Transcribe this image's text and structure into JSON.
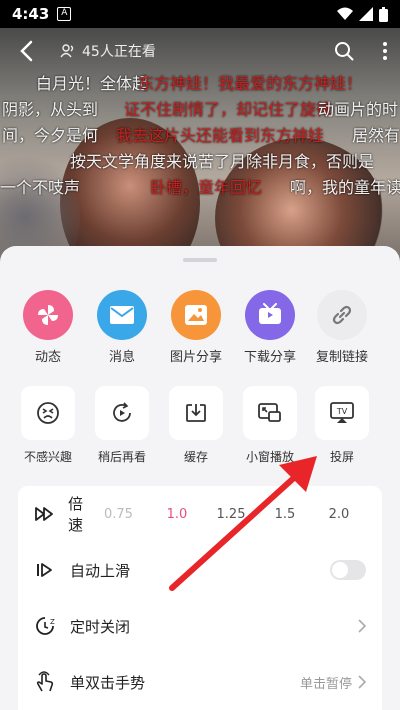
{
  "status_bar": {
    "time": "4:43",
    "notification": "A"
  },
  "top_bar": {
    "viewers": "45人正在看"
  },
  "danmaku": [
    {
      "text": "白月光！全体起",
      "color": "white"
    },
    {
      "text": "东方神娃！我最爱的东方神娃！",
      "color": "red"
    },
    {
      "text": "阴影，从头到",
      "color": "white"
    },
    {
      "text": "证不住剧情了，却记住了旋律",
      "color": "red"
    },
    {
      "text": "动画片的时",
      "color": "white"
    },
    {
      "text": "间，今夕是何",
      "color": "white"
    },
    {
      "text": "我去这片头还能看到东方神娃",
      "color": "red"
    },
    {
      "text": "居然有",
      "color": "white"
    },
    {
      "text": "按天文学角度来说苦了月除非月食，否则是",
      "color": "white"
    },
    {
      "text": "一个不吱声",
      "color": "white"
    },
    {
      "text": "卧槽，童年回忆",
      "color": "red"
    },
    {
      "text": "啊，我的童年读",
      "color": "white"
    }
  ],
  "share": [
    {
      "label": "动态",
      "icon": "pinwheel-icon",
      "color": "#f0648e"
    },
    {
      "label": "消息",
      "icon": "envelope-icon",
      "color": "#3aa7e8"
    },
    {
      "label": "图片分享",
      "icon": "image-icon",
      "color": "#f7953a"
    },
    {
      "label": "下载分享",
      "icon": "tv-download-icon",
      "color": "#8468e8"
    },
    {
      "label": "复制链接",
      "icon": "link-icon",
      "color": "#ececef"
    }
  ],
  "actions": [
    {
      "label": "不感兴趣",
      "icon": "dislike-face-icon"
    },
    {
      "label": "稍后再看",
      "icon": "watch-later-icon"
    },
    {
      "label": "缓存",
      "icon": "cache-icon"
    },
    {
      "label": "小窗播放",
      "icon": "mini-window-icon"
    },
    {
      "label": "投屏",
      "icon": "cast-tv-icon"
    }
  ],
  "settings": {
    "speed": {
      "label": "倍速",
      "options": [
        "0.75",
        "1.0",
        "1.25",
        "1.5",
        "2.0"
      ],
      "selected": "1.0"
    },
    "autoplay": {
      "label": "自动上滑",
      "enabled": false
    },
    "timer": {
      "label": "定时关闭"
    },
    "gesture": {
      "label": "单双击手势",
      "value": "单击暂停"
    }
  },
  "colors": {
    "accent": "#e94f7a",
    "annotation_arrow": "#e8262a"
  }
}
